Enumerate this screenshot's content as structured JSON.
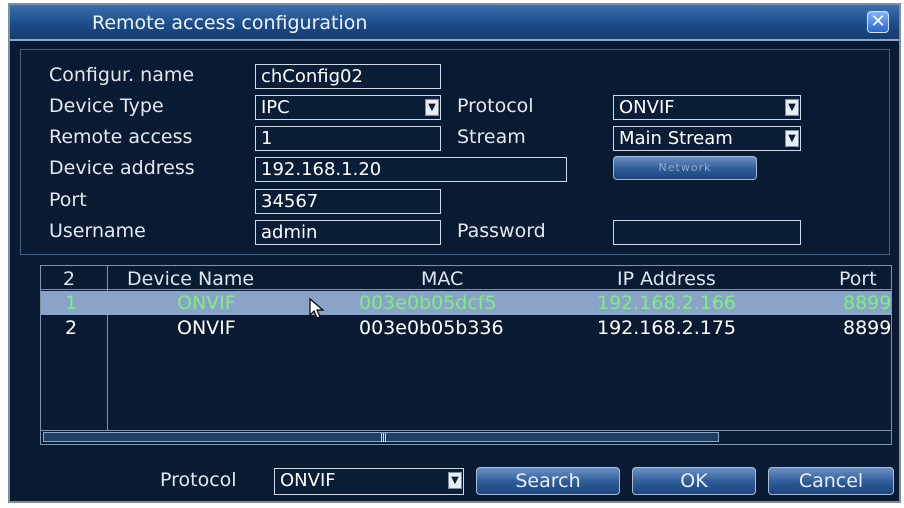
{
  "window": {
    "title": "Remote access configuration",
    "close_glyph": "✕"
  },
  "form": {
    "config_name": {
      "label": "Configur. name",
      "value": "chConfig02"
    },
    "device_type": {
      "label": "Device Type",
      "value": "IPC"
    },
    "protocol": {
      "label": "Protocol",
      "value": "ONVIF"
    },
    "remote_access": {
      "label": "Remote access",
      "value": "1"
    },
    "stream": {
      "label": "Stream",
      "value": "Main Stream"
    },
    "device_address": {
      "label": "Device address",
      "value": "192.168.1.20"
    },
    "network_button": "Network",
    "port": {
      "label": "Port",
      "value": "34567"
    },
    "username": {
      "label": "Username",
      "value": "admin"
    },
    "password": {
      "label": "Password",
      "value": ""
    }
  },
  "device_list": {
    "columns": [
      "2",
      "Device Name",
      "MAC",
      "IP Address",
      "Port"
    ],
    "rows": [
      {
        "index": "1",
        "name": "ONVIF",
        "mac": "003e0b05dcf5",
        "ip": "192.168.2.166",
        "port": "8899",
        "selected": true
      },
      {
        "index": "2",
        "name": "ONVIF",
        "mac": "003e0b05b336",
        "ip": "192.168.2.175",
        "port": "8899",
        "selected": false
      }
    ],
    "scroll_grip": "|||"
  },
  "footer": {
    "protocol_label": "Protocol",
    "protocol_value": "ONVIF",
    "search_label": "Search",
    "ok_label": "OK",
    "cancel_label": "Cancel"
  },
  "colors": {
    "background": "#081b33",
    "title_bar": "#1d4d8a",
    "selected_row": "#8aa3c9",
    "selected_text": "#7cf07c"
  },
  "icons": [
    "close-icon",
    "dropdown-arrow-icon",
    "mouse-pointer-icon"
  ]
}
